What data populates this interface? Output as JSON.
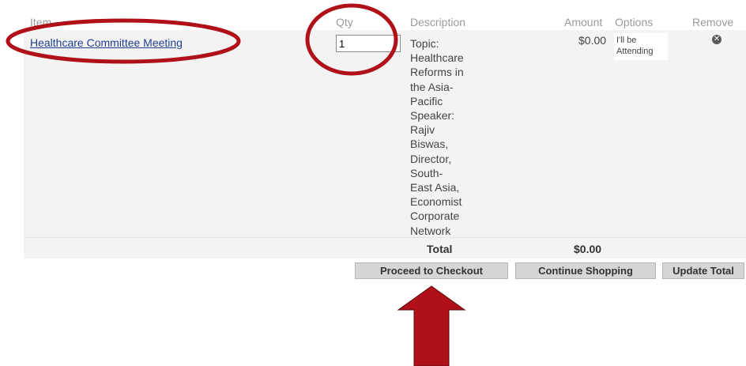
{
  "table": {
    "headers": {
      "item": "Item",
      "qty": "Qty",
      "description": "Description",
      "amount": "Amount",
      "options": "Options",
      "remove": "Remove"
    },
    "row": {
      "item_name": "Healthcare Committee Meeting",
      "qty_value": "1",
      "description_lines": [
        "Topic:",
        "Healthcare",
        "Reforms in",
        "the Asia-",
        "Pacific",
        "Speaker:",
        "Rajiv",
        "Biswas,",
        "Director,",
        "South-",
        "East Asia,",
        "Economist",
        "Corporate",
        "Network"
      ],
      "amount": "$0.00",
      "option_line1": "I'll be",
      "option_line2": "Attending",
      "remove_icon": "remove-circle-x-icon"
    },
    "total": {
      "label": "Total",
      "value": "$0.00"
    }
  },
  "buttons": {
    "checkout": "Proceed to Checkout",
    "continue": "Continue Shopping",
    "update": "Update Total"
  },
  "annotations": {
    "color": "#b01018"
  }
}
